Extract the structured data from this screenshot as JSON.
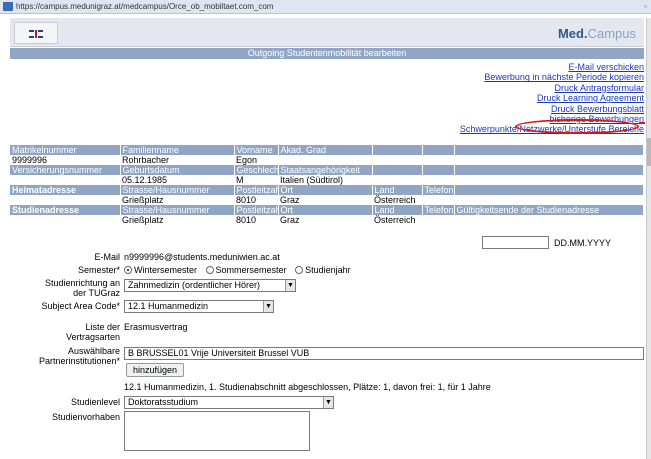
{
  "browser": {
    "url": "https://campus.medunigraz.at/medcampus/Orce_ob_mobiltaet.com_com"
  },
  "header": {
    "brand_part1": "Med.",
    "brand_part2": "Campus",
    "page_title": "Outgoing Studentenmobilität bearbeiten"
  },
  "actions": [
    "E-Mail verschicken",
    "Bewerbung in nächste Periode kopieren",
    "Druck Antragsformular",
    "Druck Learning Agreement",
    "Druck Bewerbungsblatt",
    "bisherige Bewerbungen",
    "Schwerpunkte/Netzwerke/Unterstufe Bereiche"
  ],
  "person": {
    "headers": [
      "Matrikelnummer",
      "Familienname",
      "Vorname",
      "Akad. Grad",
      "",
      "",
      ""
    ],
    "values": [
      "9999996",
      "Rohrbacher",
      "Egon",
      "",
      "",
      "",
      ""
    ],
    "headers2": [
      "Versicherungsnummer",
      "Geburtsdatum",
      "Geschlecht",
      "Staatsangehörigkeit",
      "",
      "",
      ""
    ],
    "values2": [
      "",
      "05.12.1985",
      "M",
      "Italien (Südtirol)",
      "",
      "",
      ""
    ]
  },
  "heimat": {
    "headers": [
      "Heimatadresse",
      "Strasse/Hausnummer",
      "Postleitzahl",
      "Ort",
      "Land",
      "Telefon",
      ""
    ],
    "values": [
      "",
      "Grießplatz",
      "8010",
      "Graz",
      "Österreich",
      "",
      ""
    ]
  },
  "studien": {
    "headers": [
      "Studienadresse",
      "Strasse/Hausnummer",
      "Postleitzahl",
      "Ort",
      "Land",
      "Telefon",
      "Gültigkeitsende der Studienadresse"
    ],
    "values": [
      "",
      "Grießplatz",
      "8010",
      "Graz",
      "Österreich",
      "",
      ""
    ],
    "date_placeholder": "DD.MM.YYYY"
  },
  "form": {
    "email_label": "E-Mail",
    "email_value": "n9999996@students.meduniwien.ac.at",
    "semester_label": "Semester*",
    "semester_options": [
      "Wintersemester",
      "Sommersemester",
      "Studienjahr"
    ],
    "studienrichtung_label_1": "Studienrichtung an",
    "studienrichtung_label_2": "der TUGraz",
    "studienrichtung_value": "Zahnmedizin (ordentlicher Hörer)",
    "subject_label": "Subject Area Code*",
    "subject_value": "12.1 Humanmedizin",
    "vertragsarten_label_1": "Liste der",
    "vertragsarten_label_2": "Vertragsarten",
    "vertragsarten_value": "Erasmusvertrag",
    "partner_label_1": "Auswählbare",
    "partner_label_2": "Partnerinstitutionen*",
    "partner_value": "B BRUSSEL01 Vrije Universiteit Brussel VUB",
    "add_button": "hinzufügen",
    "partner_info": "12.1 Humanmedizin, 1. Studienabschnitt abgeschlossen, Plätze: 1, davon frei: 1, für 1 Jahre",
    "studienlevel_label": "Studienlevel",
    "studienlevel_value": "Doktoratsstudium",
    "vorhaben_label": "Studienvorhaben"
  }
}
